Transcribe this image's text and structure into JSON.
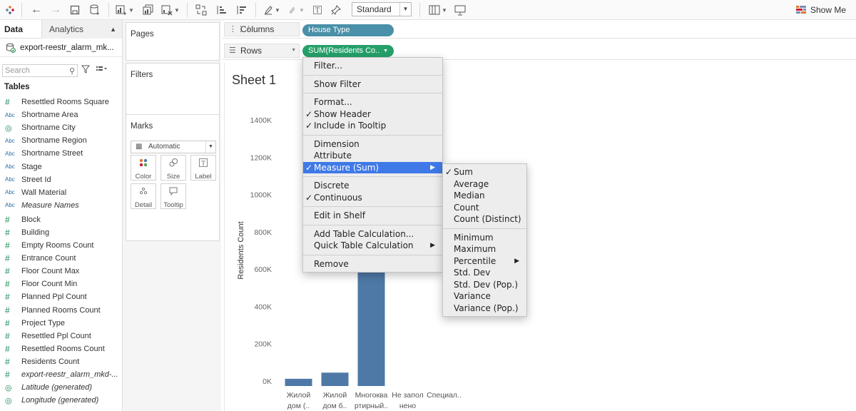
{
  "toolbar": {
    "standard_label": "Standard",
    "show_me_label": "Show Me"
  },
  "data_pane": {
    "tab_data": "Data",
    "tab_analytics": "Analytics",
    "datasource": "export-reestr_alarm_mk...",
    "search_placeholder": "Search",
    "tables_heading": "Tables",
    "fields": [
      {
        "type": "measure",
        "label": "Resettled Rooms Square",
        "italic": false
      },
      {
        "type": "dimension",
        "label": "Shortname Area",
        "italic": false
      },
      {
        "type": "geo",
        "label": "Shortname City",
        "italic": false
      },
      {
        "type": "dimension",
        "label": "Shortname Region",
        "italic": false
      },
      {
        "type": "dimension",
        "label": "Shortname Street",
        "italic": false
      },
      {
        "type": "dimension",
        "label": "Stage",
        "italic": false
      },
      {
        "type": "dimension",
        "label": "Street Id",
        "italic": false
      },
      {
        "type": "dimension",
        "label": "Wall Material",
        "italic": false
      },
      {
        "type": "dimension",
        "label": "Measure Names",
        "italic": true
      },
      {
        "type": "gap"
      },
      {
        "type": "measure",
        "label": "Block",
        "italic": false
      },
      {
        "type": "measure",
        "label": "Building",
        "italic": false
      },
      {
        "type": "measure",
        "label": "Empty Rooms Count",
        "italic": false
      },
      {
        "type": "measure",
        "label": "Entrance Count",
        "italic": false
      },
      {
        "type": "measure",
        "label": "Floor Count Max",
        "italic": false
      },
      {
        "type": "measure",
        "label": "Floor Count Min",
        "italic": false
      },
      {
        "type": "measure",
        "label": "Planned Ppl Count",
        "italic": false
      },
      {
        "type": "measure",
        "label": "Planned Rooms Count",
        "italic": false
      },
      {
        "type": "measure",
        "label": "Project Type",
        "italic": false
      },
      {
        "type": "measure",
        "label": "Resettled Ppl Count",
        "italic": false
      },
      {
        "type": "measure",
        "label": "Resettled Rooms Count",
        "italic": false
      },
      {
        "type": "measure",
        "label": "Residents Count",
        "italic": false
      },
      {
        "type": "measure",
        "label": "export-reestr_alarm_mkd-...",
        "italic": true
      },
      {
        "type": "geo",
        "label": "Latitude (generated)",
        "italic": true
      },
      {
        "type": "geo",
        "label": "Longitude (generated)",
        "italic": true
      }
    ]
  },
  "cards": {
    "pages": "Pages",
    "filters": "Filters",
    "marks": "Marks",
    "mark_type": "Automatic",
    "mark_buttons": [
      {
        "label": "Color",
        "icon": "color-icon"
      },
      {
        "label": "Size",
        "icon": "size-icon"
      },
      {
        "label": "Label",
        "icon": "label-icon"
      },
      {
        "label": "Detail",
        "icon": "detail-icon"
      },
      {
        "label": "Tooltip",
        "icon": "tooltip-icon"
      }
    ]
  },
  "shelves": {
    "columns_label": "Columns",
    "rows_label": "Rows",
    "columns_pill": "House Type",
    "rows_pill": "SUM(Residents Co.."
  },
  "sheet": {
    "title": "Sheet 1"
  },
  "chart_data": {
    "type": "bar",
    "ylabel": "Residents Count",
    "ylim": [
      0,
      1400000
    ],
    "y_ticks": [
      0,
      200000,
      400000,
      600000,
      800000,
      1000000,
      1200000,
      1400000
    ],
    "y_tick_labels": [
      "0K",
      "200K",
      "400K",
      "600K",
      "800K",
      "1000K",
      "1200K",
      "1400K"
    ],
    "categories": [
      [
        "Жилой",
        "дом (.."
      ],
      [
        "Жилой",
        "дом б.."
      ],
      [
        "Многоква",
        "ртирный.."
      ],
      [
        "Не запол",
        "нено"
      ],
      [
        "Специал..",
        ""
      ]
    ],
    "values": [
      12000,
      45000,
      1400000,
      0,
      0
    ],
    "bar_color": "#4e79a7"
  },
  "context_menu": {
    "items": [
      {
        "label": "Filter...",
        "checked": false
      },
      {
        "sep": true
      },
      {
        "label": "Show Filter",
        "checked": false
      },
      {
        "sep": true
      },
      {
        "label": "Format...",
        "checked": false
      },
      {
        "label": "Show Header",
        "checked": true
      },
      {
        "label": "Include in Tooltip",
        "checked": true
      },
      {
        "sep": true
      },
      {
        "label": "Dimension",
        "checked": false
      },
      {
        "label": "Attribute",
        "checked": false
      },
      {
        "label": "Measure (Sum)",
        "checked": true,
        "submenu": true,
        "highlighted": true
      },
      {
        "sep": true
      },
      {
        "label": "Discrete",
        "checked": false
      },
      {
        "label": "Continuous",
        "checked": true
      },
      {
        "sep": true
      },
      {
        "label": "Edit in Shelf",
        "checked": false
      },
      {
        "sep": true
      },
      {
        "label": "Add Table Calculation...",
        "checked": false
      },
      {
        "label": "Quick Table Calculation",
        "checked": false,
        "submenu": true
      },
      {
        "sep": true
      },
      {
        "label": "Remove",
        "checked": false
      }
    ],
    "submenu_items": [
      {
        "label": "Sum",
        "checked": true
      },
      {
        "label": "Average",
        "checked": false
      },
      {
        "label": "Median",
        "checked": false
      },
      {
        "label": "Count",
        "checked": false
      },
      {
        "label": "Count (Distinct)",
        "checked": false
      },
      {
        "sep": true
      },
      {
        "label": "Minimum",
        "checked": false
      },
      {
        "label": "Maximum",
        "checked": false
      },
      {
        "label": "Percentile",
        "checked": false,
        "submenu": true
      },
      {
        "label": "Std. Dev",
        "checked": false
      },
      {
        "label": "Std. Dev (Pop.)",
        "checked": false
      },
      {
        "label": "Variance",
        "checked": false
      },
      {
        "label": "Variance (Pop.)",
        "checked": false
      }
    ]
  }
}
